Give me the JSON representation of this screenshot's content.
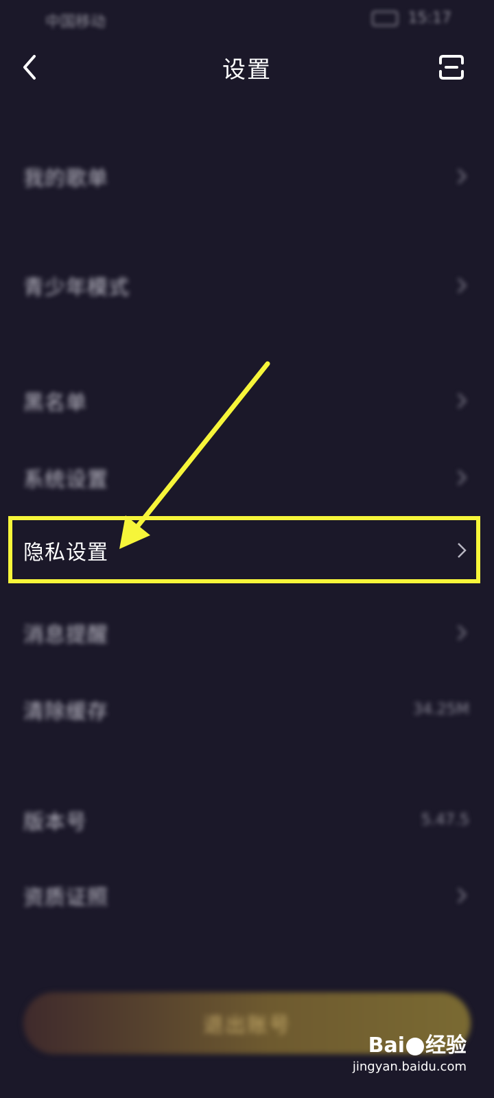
{
  "status_bar": {
    "carrier": "中国移动",
    "time": "15:17"
  },
  "nav": {
    "title": "设置",
    "back_icon": "chevron-left-icon",
    "scan_icon": "scan-icon"
  },
  "rows": [
    {
      "id": "my-orders",
      "label": "我的歌单",
      "value": "",
      "chevron": true
    },
    {
      "id": "teen-mode",
      "label": "青少年模式",
      "value": "",
      "chevron": true
    },
    {
      "id": "blacklist",
      "label": "黑名单",
      "value": "",
      "chevron": true
    },
    {
      "id": "system-settings",
      "label": "系统设置",
      "value": "",
      "chevron": true
    },
    {
      "id": "privacy-settings",
      "label": "隐私设置",
      "value": "",
      "chevron": true
    },
    {
      "id": "message-notify",
      "label": "消息提醒",
      "value": "",
      "chevron": true
    },
    {
      "id": "clear-cache",
      "label": "清除缓存",
      "value": "34.25M",
      "chevron": false
    },
    {
      "id": "version",
      "label": "版本号",
      "value": "5.47.5",
      "chevron": false
    },
    {
      "id": "license",
      "label": "资质证照",
      "value": "",
      "chevron": true
    }
  ],
  "logout": {
    "label": "退出账号"
  },
  "annotation": {
    "color": "#f6f53a"
  },
  "watermark": {
    "brand_left": "Bai",
    "brand_right": "经验",
    "url": "jingyan.baidu.com"
  }
}
